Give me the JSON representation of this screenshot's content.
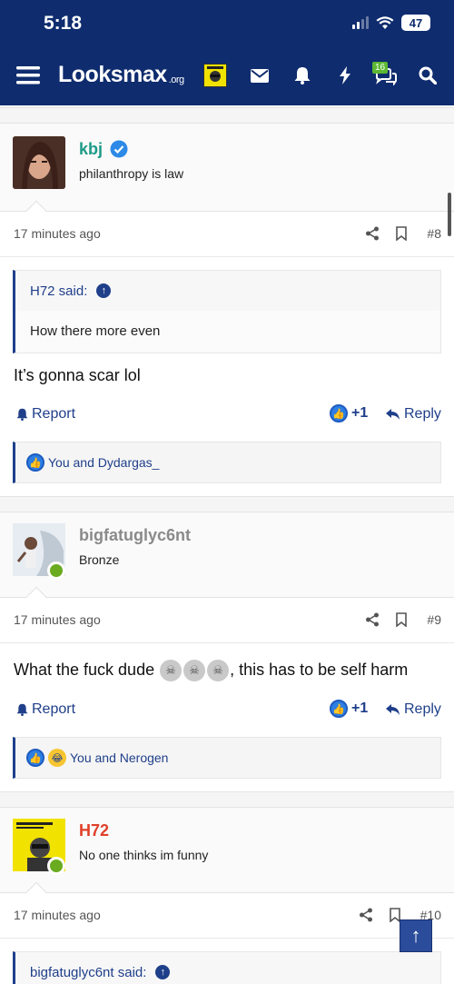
{
  "status_bar": {
    "time": "5:18",
    "battery": "47"
  },
  "site": {
    "logo": "Looksmax",
    "logo_suffix": ".org",
    "notification_count": "16"
  },
  "posts": [
    {
      "username": "kbj",
      "username_color": "#1d9a87",
      "verified": true,
      "user_title": "philanthropy is law",
      "timestamp": "17 minutes ago",
      "post_number": "#8",
      "quote_author": "H72 said:",
      "quote_text": "How there more even",
      "body": "It’s gonna scar lol",
      "report_label": "Report",
      "like_count": "+1",
      "reply_label": "Reply",
      "reactions_text": "You and Dydargas_"
    },
    {
      "username": "bigfatuglyc6nt",
      "username_color": "#8a8a8a",
      "user_title": "Bronze",
      "timestamp": "17 minutes ago",
      "post_number": "#9",
      "body_before": "What the fuck dude",
      "body_after": ", this has to be self harm",
      "report_label": "Report",
      "like_count": "+1",
      "reply_label": "Reply",
      "reactions_text": "You and Nerogen"
    },
    {
      "username": "H72",
      "username_color": "#e0402a",
      "user_title": "No one thinks im funny",
      "timestamp": "17 minutes ago",
      "post_number": "#10",
      "quote_author": "bigfatuglyc6nt said:"
    }
  ],
  "colors": {
    "header": "#0f2c6e",
    "link": "#1f3f8a",
    "online": "#6aab1f"
  },
  "icons": [
    "menu-icon",
    "mail-icon",
    "bell-icon",
    "bolt-icon",
    "chat-icon",
    "search-icon",
    "share-icon",
    "bookmark-icon",
    "up-arrow-icon",
    "like-icon",
    "laugh-icon",
    "reply-icon",
    "skull-icon",
    "verified-icon"
  ]
}
